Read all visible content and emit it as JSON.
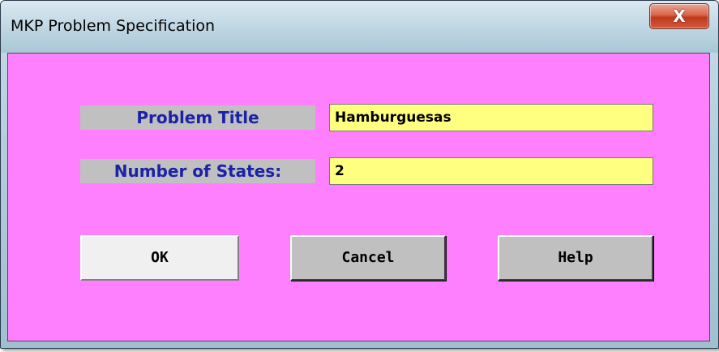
{
  "window": {
    "title": "MKP Problem Specification",
    "close_glyph": "X"
  },
  "form": {
    "problem_title_label": "Problem Title",
    "problem_title_value": "Hamburguesas",
    "num_states_label": "Number of States:",
    "num_states_value": "2"
  },
  "buttons": {
    "ok": "OK",
    "cancel": "Cancel",
    "help": "Help"
  },
  "colors": {
    "client_background": "#ff80ff",
    "label_background": "#c0c0c0",
    "label_text": "#1a22a8",
    "field_background": "#ffff80"
  }
}
